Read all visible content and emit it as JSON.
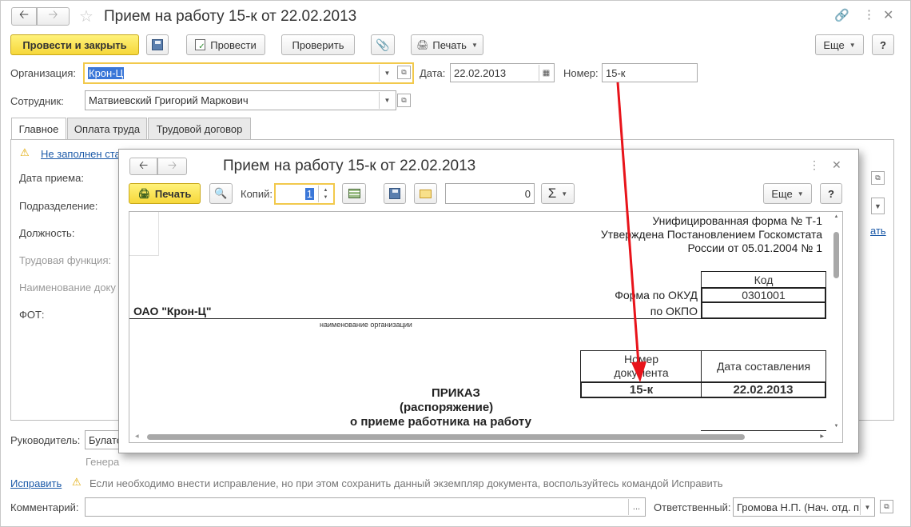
{
  "window": {
    "title": "Прием на работу 15-к от 22.02.2013"
  },
  "toolbar": {
    "post_close": "Провести и закрыть",
    "post": "Провести",
    "check": "Проверить",
    "print": "Печать",
    "more": "Еще",
    "help": "?"
  },
  "fields": {
    "org_label": "Организация:",
    "org_value": "Крон-Ц",
    "date_label": "Дата:",
    "date_value": "22.02.2013",
    "number_label": "Номер:",
    "number_value": "15-к",
    "employee_label": "Сотрудник:",
    "employee_value": "Матвиевский Григорий Маркович"
  },
  "tabs": [
    "Главное",
    "Оплата труда",
    "Трудовой договор"
  ],
  "main": {
    "warning": "Не заполнен ста",
    "hire_date": "Дата приема:",
    "department": "Подразделение:",
    "position": "Должность:",
    "labor_function": "Трудовая функция:",
    "doc_name": "Наименование доку",
    "fot": "ФОТ:",
    "right_link": "ать"
  },
  "bottom": {
    "head_label": "Руководитель:",
    "head_value": "Булато",
    "head_position": "Генера",
    "fix_link": "Исправить",
    "fix_hint": "Если необходимо внести исправление, но при этом сохранить данный экземпляр документа, воспользуйтесь командой Исправить",
    "comment_label": "Комментарий:",
    "comment_btn": "...",
    "responsible_label": "Ответственный:",
    "responsible_value": "Громова Н.П. (Нач. отд. п"
  },
  "print_window": {
    "title": "Прием на работу 15-к от 22.02.2013",
    "print_btn": "Печать",
    "copies_label": "Копий:",
    "copies_value": "1",
    "sum_value": "0",
    "sigma": "Σ",
    "more": "Еще",
    "help": "?"
  },
  "print_form": {
    "header_line1": "Унифицированная форма № Т-1",
    "header_line2": "Утверждена Постановлением Госкомстата",
    "header_line3": "России от 05.01.2004 № 1",
    "code_header": "Код",
    "okud_label": "Форма по ОКУД",
    "okud_value": "0301001",
    "okpo_label": "по ОКПО",
    "okpo_value": "",
    "org_name": "ОАО \"Крон-Ц\"",
    "org_caption": "наименование организации",
    "doc_number_header": "Номер документа",
    "doc_date_header": "Дата составления",
    "doc_number": "15-к",
    "doc_date": "22.02.2013",
    "title1": "ПРИКАЗ",
    "title2": "(распоряжение)",
    "title3": "о приеме работника на работу"
  },
  "colors": {
    "accent_yellow": "#f6d73a",
    "link": "#1c5aa8",
    "arrow": "#e8141b",
    "focus": "#f2c94c"
  }
}
